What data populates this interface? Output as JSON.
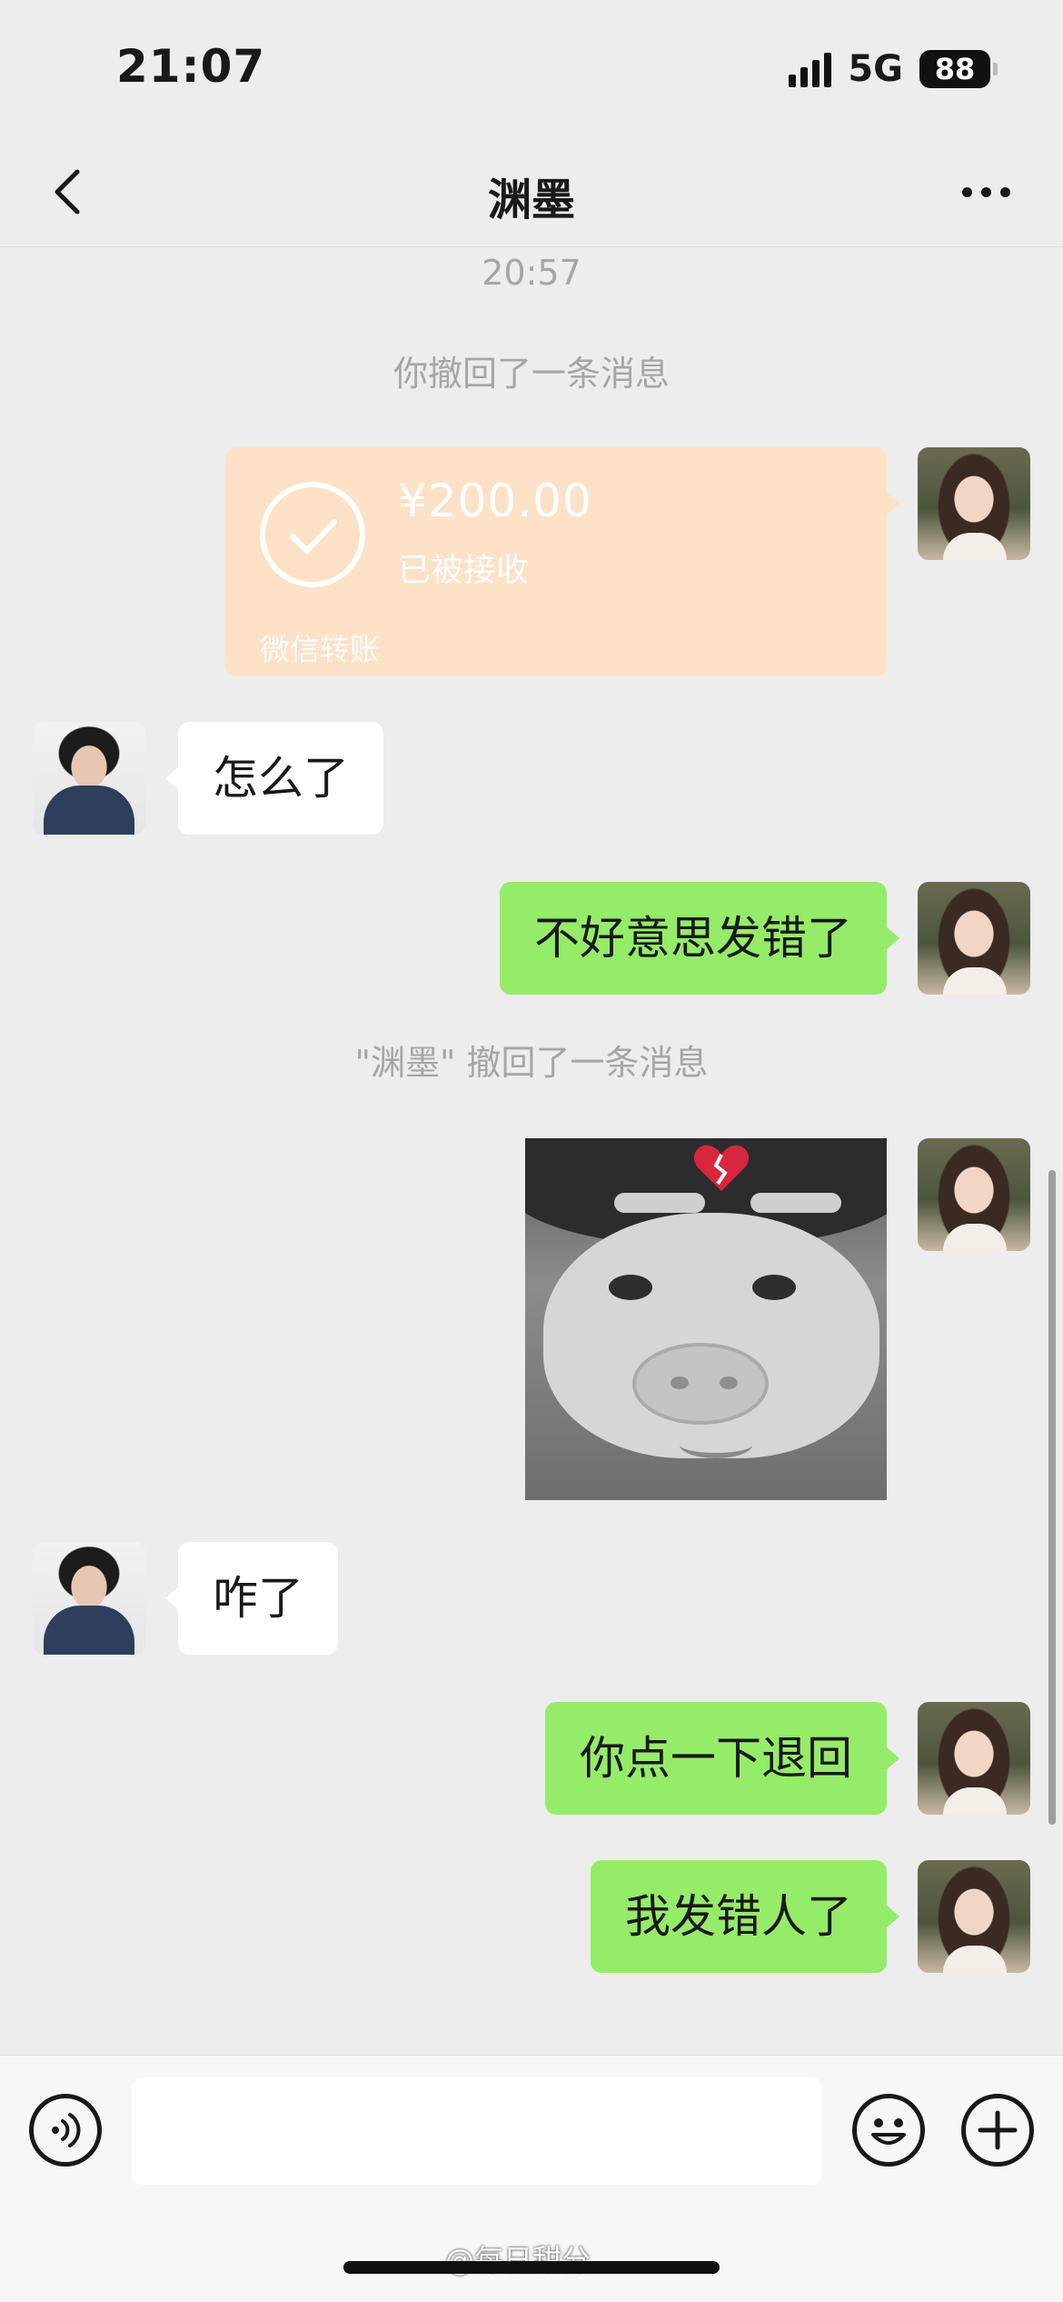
{
  "status_bar": {
    "time": "21:07",
    "network": "5G",
    "battery": "88"
  },
  "nav": {
    "title": "渊墨",
    "back_icon": "chevron-left-icon",
    "more_icon": "more-dots-icon"
  },
  "messages": {
    "timestamp": "20:57",
    "recall_self": "你撤回了一条消息",
    "transfer": {
      "amount": "¥200.00",
      "status": "已被接收",
      "label": "微信转账"
    },
    "msg_other_1": "怎么了",
    "msg_self_1": "不好意思发错了",
    "recall_other": "\"渊墨\" 撤回了一条消息",
    "sticker": "broken-heart pig sticker",
    "msg_other_2": "咋了",
    "msg_self_2": "你点一下退回",
    "msg_self_3": "我发错人了"
  },
  "input_bar": {
    "placeholder": "",
    "voice_icon": "voice-icon",
    "emoji_icon": "emoji-icon",
    "plus_icon": "plus-icon"
  },
  "watermark": "@每日甜分",
  "colors": {
    "background": "#ededed",
    "self_bubble": "#95ec69",
    "other_bubble": "#ffffff",
    "transfer_card": "#fde2c8",
    "system_text": "#a6a6a6"
  }
}
